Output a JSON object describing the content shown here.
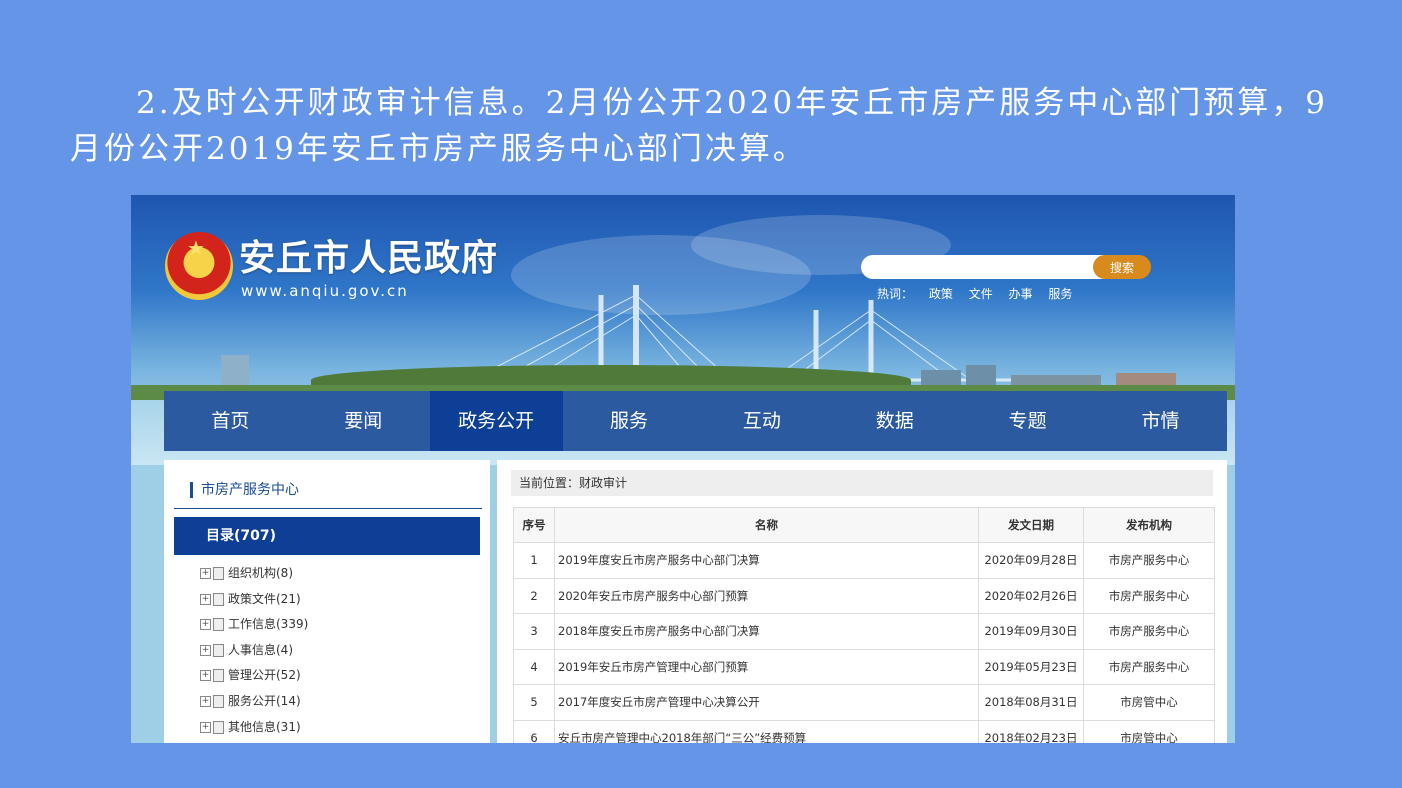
{
  "slide": {
    "paragraph": "2.及时公开财政审计信息。2月份公开2020年安丘市房产服务中心部门预算，9月份公开2019年安丘市房产服务中心部门决算。"
  },
  "site": {
    "name": "安丘市人民政府",
    "url": "www.anqiu.gov.cn",
    "emblem_icon": "national-emblem",
    "search": {
      "placeholder": "",
      "button": "搜索"
    },
    "hotwords": {
      "label": "热词：",
      "items": [
        "政策",
        "文件",
        "办事",
        "服务"
      ]
    }
  },
  "nav": {
    "items": [
      "首页",
      "要闻",
      "政务公开",
      "服务",
      "互动",
      "数据",
      "专题",
      "市情"
    ],
    "active": "政务公开"
  },
  "sidebar": {
    "title": "市房产服务中心",
    "catalog": "目录(707)",
    "items": [
      "组织机构(8)",
      "政策文件(21)",
      "工作信息(339)",
      "人事信息(4)",
      "管理公开(52)",
      "服务公开(14)",
      "其他信息(31)"
    ]
  },
  "main": {
    "breadcrumb": "当前位置：财政审计",
    "columns": [
      "序号",
      "名称",
      "发文日期",
      "发布机构"
    ],
    "rows": [
      {
        "no": "1",
        "title": "2019年度安丘市房产服务中心部门决算",
        "date": "2020年09月28日",
        "org": "市房产服务中心"
      },
      {
        "no": "2",
        "title": "2020年安丘市房产服务中心部门预算",
        "date": "2020年02月26日",
        "org": "市房产服务中心"
      },
      {
        "no": "3",
        "title": "2018年度安丘市房产服务中心部门决算",
        "date": "2019年09月30日",
        "org": "市房产服务中心"
      },
      {
        "no": "4",
        "title": "2019年安丘市房产管理中心部门预算",
        "date": "2019年05月23日",
        "org": "市房产服务中心"
      },
      {
        "no": "5",
        "title": "2017年度安丘市房产管理中心决算公开",
        "date": "2018年08月31日",
        "org": "市房管中心"
      },
      {
        "no": "6",
        "title": "安丘市房产管理中心2018年部门“三公”经费预算",
        "date": "2018年02月23日",
        "org": "市房管中心"
      }
    ]
  },
  "colors": {
    "slide_bg": "#6495e6",
    "nav_bg": "#2b5aa0",
    "nav_active": "#0d3f96",
    "search_button": "#d88a1c"
  }
}
